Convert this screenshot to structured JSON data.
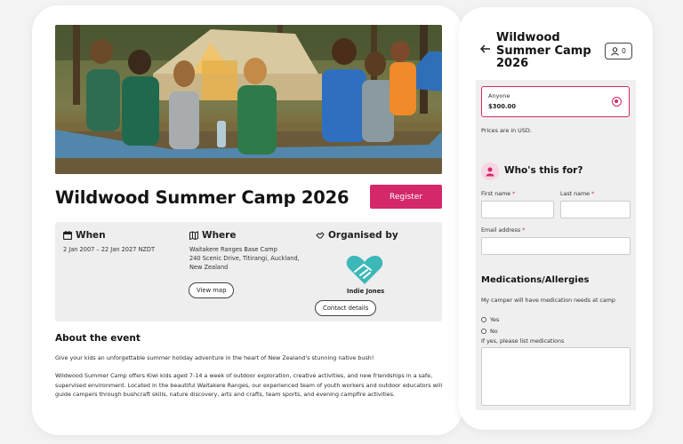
{
  "event": {
    "title": "Wildwood Summer Camp 2026",
    "register_label": "Register",
    "hero_icon": "camp-photo"
  },
  "when": {
    "heading": "When",
    "dates": "2 Jan 2007 – 22 Jan 2027 NZDT"
  },
  "where": {
    "heading": "Where",
    "venue": "Waitakere Ranges Base Camp",
    "address_line1": "240 Scenic Drive, Titirangi, Auckland,",
    "address_line2": "New Zealand",
    "map_label": "View map"
  },
  "organiser": {
    "heading": "Organised by",
    "name": "Indie Jones",
    "contact_label": "Contact details"
  },
  "about": {
    "heading": "About the event",
    "p1": "Give your kids an unforgettable summer holiday adventure in the heart of New Zealand's stunning native bush!",
    "p2": "Wildwood Summer Camp offers Kiwi kids aged 7-14 a week of outdoor exploration, creative activities, and new friendships in a safe, supervised environment. Located in the beautiful Waitakere Ranges, our experienced team of youth workers and outdoor educators will guide campers through bushcraft skills, nature discovery, arts and crafts, team sports, and evening campfire activities."
  },
  "checkout": {
    "title": "Wildwood Summer Camp 2026",
    "cart_count": "0",
    "ticket_name": "Anyone",
    "ticket_price": "$300.00",
    "currency_note": "Prices are in USD.",
    "who_heading": "Who's this for?",
    "first_name_label": "First name",
    "last_name_label": "Last name",
    "email_label": "Email address",
    "required_mark": "*",
    "med_heading": "Medications/Allergies",
    "med_question": "My camper will have medication needs at camp",
    "opt_yes": "Yes",
    "opt_no": "No",
    "med_list_label": "If yes, please list medications"
  },
  "colors": {
    "accent": "#d4286a",
    "panel_bg": "#eeeeee",
    "logo_teal": "#3cb8b8"
  }
}
